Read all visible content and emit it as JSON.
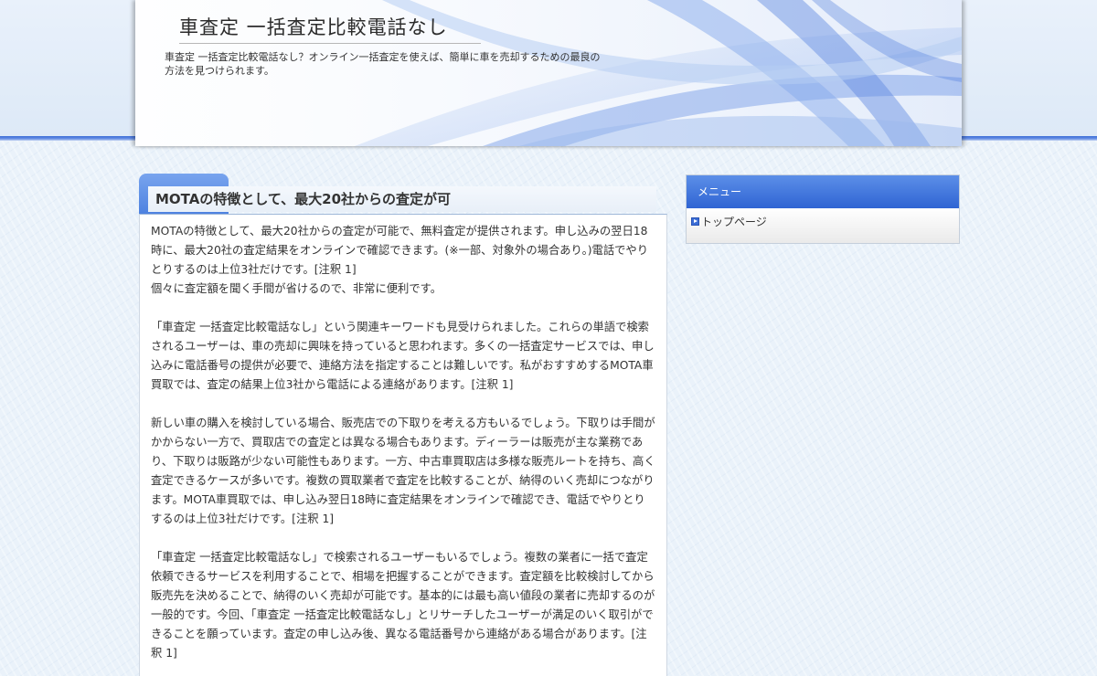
{
  "header": {
    "title": "車査定 一括査定比較電話なし",
    "description": "車査定 一括査定比較電話なし？オンライン一括査定を使えば、簡単に車を売却するための最良の方法を見つけられます。"
  },
  "entry": {
    "title": "MOTAの特徴として、最大20社からの査定が可",
    "paragraphs": [
      "MOTAの特徴として、最大20社からの査定が可能で、無料査定が提供されます。申し込みの翌日18時に、最大20社の査定結果をオンラインで確認できます。(※一部、対象外の場合あり。)電話でやりとりするのは上位3社だけです。[注釈 1]\n個々に査定額を聞く手間が省けるので、非常に便利です。",
      "「車査定 一括査定比較電話なし」という関連キーワードも見受けられました。これらの単語で検索されるユーザーは、車の売却に興味を持っていると思われます。多くの一括査定サービスでは、申し込みに電話番号の提供が必要で、連絡方法を指定することは難しいです。私がおすすめするMOTA車買取では、査定の結果上位3社から電話による連絡があります。[注釈 1]",
      "新しい車の購入を検討している場合、販売店での下取りを考える方もいるでしょう。下取りは手間がかからない一方で、買取店での査定とは異なる場合もあります。ディーラーは販売が主な業務であり、下取りは販路が少ない可能性もあります。一方、中古車買取店は多様な販売ルートを持ち、高く査定できるケースが多いです。複数の買取業者で査定を比較することが、納得のいく売却につながります。MOTA車買取では、申し込み翌日18時に査定結果をオンラインで確認でき、電話でやりとりするのは上位3社だけです。[注釈 1]",
      "「車査定 一括査定比較電話なし」で検索されるユーザーもいるでしょう。複数の業者に一括で査定依頼できるサービスを利用することで、相場を把握することができます。査定額を比較検討してから販売先を決めることで、納得のいく売却が可能です。基本的には最も高い値段の業者に売却するのが一般的です。今回、「車査定 一括査定比較電話なし」とリサーチしたユーザーが満足のいく取引ができることを願っています。査定の申し込み後、異なる電話番号から連絡がある場合があります。[注釈 1]"
    ]
  },
  "sidebar": {
    "heading": "メニュー",
    "items": [
      {
        "label": "トップページ",
        "icon": "arrow-bullet-icon"
      }
    ]
  },
  "colors": {
    "accent": "#3a6bd6",
    "header_bg": "#e9f1fb",
    "sidebar_header": "#2f64d3"
  }
}
